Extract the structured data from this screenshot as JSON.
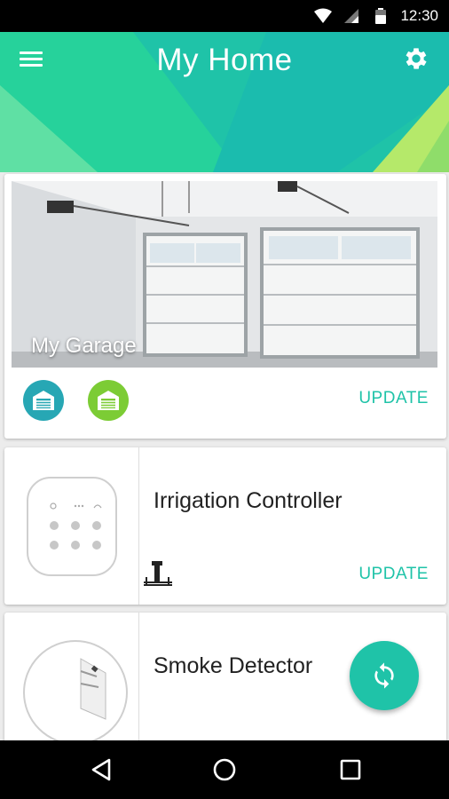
{
  "status_bar": {
    "time": "12:30"
  },
  "header": {
    "title": "My Home",
    "menu_icon": "menu-icon",
    "settings_icon": "gear-icon"
  },
  "colors": {
    "accent": "#1fc3a8",
    "door_blue": "#27a7b4",
    "door_green": "#7ccc35",
    "header_light": "#b5e96a"
  },
  "garage": {
    "label": "My Garage",
    "doors": [
      {
        "icon": "garage-door-icon",
        "color": "#27a7b4"
      },
      {
        "icon": "garage-door-icon",
        "color": "#7ccc35"
      }
    ],
    "update_label": "UPDATE"
  },
  "irrigation": {
    "name": "Irrigation Controller",
    "update_label": "UPDATE",
    "status_icon": "sprinkler-valve-icon"
  },
  "smoke": {
    "name": "Smoke Detector"
  },
  "fab": {
    "icon": "refresh-icon"
  },
  "nav": {
    "back_icon": "back-icon",
    "home_icon": "home-icon",
    "recents_icon": "recents-icon"
  }
}
